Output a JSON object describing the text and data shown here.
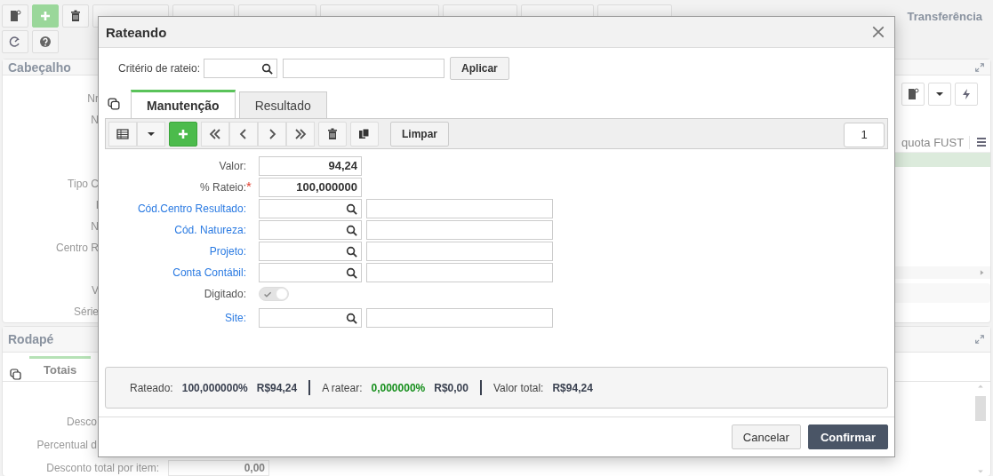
{
  "toolbar": {
    "page_title": "Transferência"
  },
  "header_panel": {
    "title": "Cabeçalho",
    "field_labels": [
      "Nr",
      "N",
      "Tipo C",
      "I",
      "N",
      "Centro R",
      "V",
      "Série"
    ],
    "grid_column": "quota FUST"
  },
  "footer_panel": {
    "title": "Rodapé",
    "tabs": [
      {
        "label": "Totais",
        "selected": true
      }
    ],
    "fields": [
      {
        "kind": "label",
        "label": "Desco"
      },
      {
        "kind": "label",
        "label": "Percentual d"
      },
      {
        "kind": "input",
        "label": "Desconto total por item:",
        "value": "0,00"
      }
    ]
  },
  "dialog": {
    "title": "Rateando",
    "criterion": {
      "label": "Critério de rateio:",
      "button": "Aplicar"
    },
    "tabs": [
      {
        "label": "Manutenção",
        "selected": true
      },
      {
        "label": "Resultado",
        "selected": false
      }
    ],
    "record_toolbar": {
      "clear_button": "Limpar",
      "record_number": "1"
    },
    "required_mark": "*",
    "fields": [
      {
        "kind": "number",
        "label": "Valor:",
        "link": false,
        "required": false,
        "value": "94,24"
      },
      {
        "kind": "number",
        "label": "% Rateio:",
        "link": false,
        "required": true,
        "value": "100,000000"
      },
      {
        "kind": "lookup",
        "label": "Cód.Centro Resultado:",
        "link": true,
        "required": false
      },
      {
        "kind": "lookup",
        "label": "Cód. Natureza:",
        "link": true,
        "required": false
      },
      {
        "kind": "lookup",
        "label": "Projeto:",
        "link": true,
        "required": false
      },
      {
        "kind": "lookup",
        "label": "Conta Contábil:",
        "link": true,
        "required": false
      },
      {
        "kind": "toggle",
        "label": "Digitado:",
        "link": false,
        "required": false,
        "on": true,
        "disabled": true
      },
      {
        "kind": "lookup",
        "label": "Site:",
        "link": true,
        "required": false
      }
    ],
    "summary": [
      {
        "label": "Rateado:",
        "values": [
          {
            "text": "100,000000%"
          },
          {
            "text": "R$94,24"
          }
        ]
      },
      {
        "label": "A ratear:",
        "values": [
          {
            "text": "0,000000%",
            "color": "#18901e"
          },
          {
            "text": "R$0,00"
          }
        ]
      },
      {
        "label": "Valor total:",
        "values": [
          {
            "text": "R$94,24"
          }
        ]
      }
    ],
    "buttons": [
      {
        "label": "Cancelar",
        "kind": "secondary"
      },
      {
        "label": "Confirmar",
        "kind": "primary"
      }
    ]
  }
}
